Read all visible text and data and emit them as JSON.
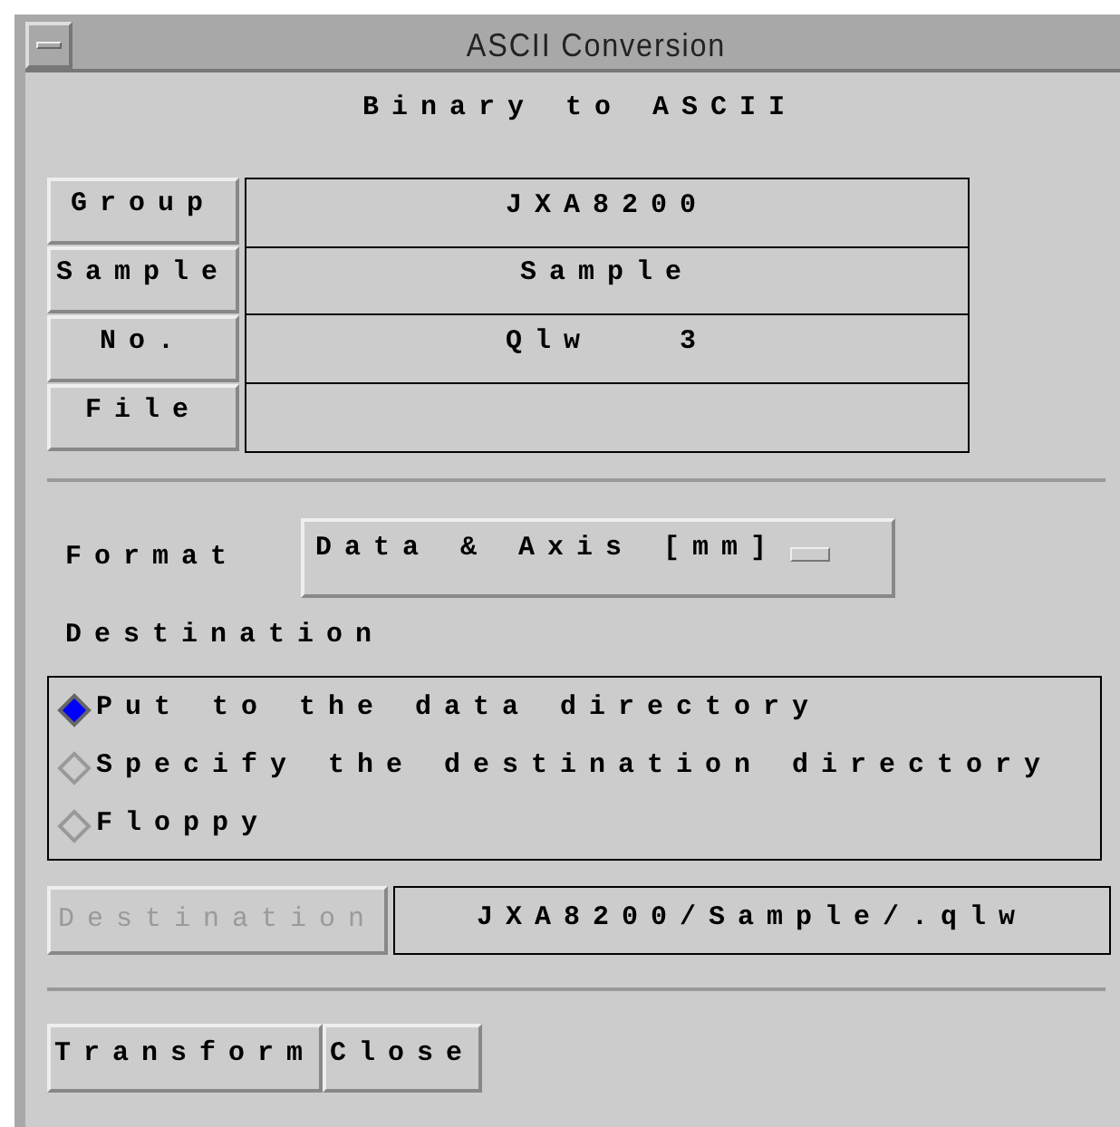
{
  "window": {
    "title": "ASCII Conversion"
  },
  "heading": "Binary to ASCII",
  "fields": [
    {
      "label": "Group",
      "value": "JXA8200"
    },
    {
      "label": "Sample",
      "value": "Sample"
    },
    {
      "label": "No.",
      "value": "Qlw   3"
    },
    {
      "label": "File"
    }
  ],
  "format": {
    "label": "Format",
    "value": "Data & Axis [mm]"
  },
  "destination": {
    "label": "Destination",
    "options": [
      {
        "label": "Put to the data directory",
        "selected": true
      },
      {
        "label": "Specify the destination directory",
        "selected": false
      },
      {
        "label": "Floppy",
        "selected": false
      }
    ]
  },
  "destination_button": {
    "label": "Destination",
    "disabled": true
  },
  "destination_path": "JXA8200/Sample/.qlw",
  "buttons": [
    {
      "label": "Transform"
    },
    {
      "label": "Close"
    }
  ]
}
